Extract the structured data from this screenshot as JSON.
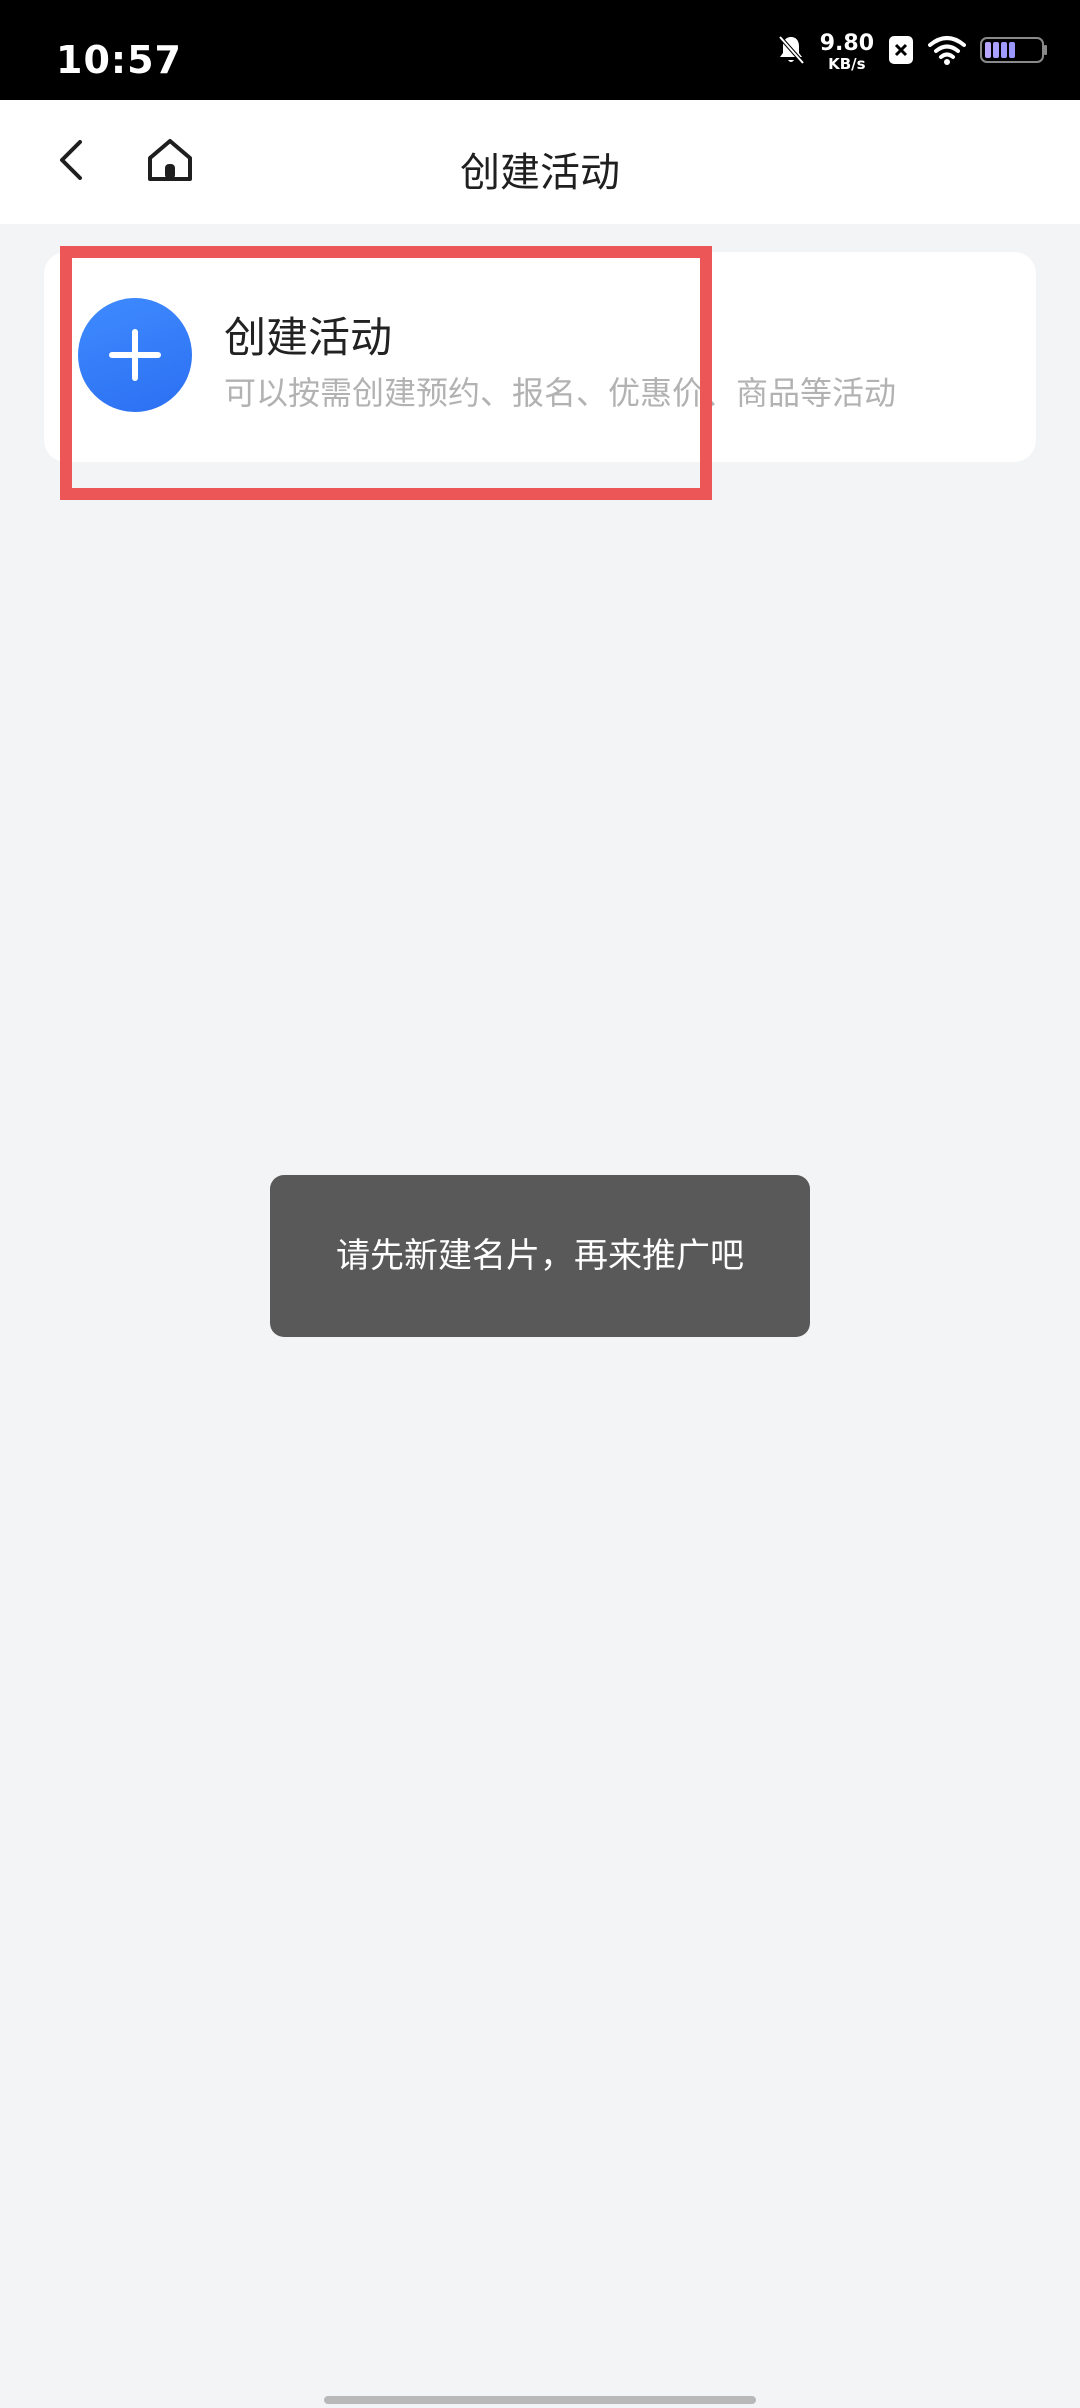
{
  "status_bar": {
    "time": "10:57",
    "net_speed_value": "9.80",
    "net_speed_unit": "KB/s",
    "icons": [
      "bell-mute-icon",
      "close-badge-icon",
      "wifi-icon",
      "battery-icon"
    ]
  },
  "header": {
    "title": "创建活动",
    "back_icon": "chevron-left-icon",
    "home_icon": "home-icon"
  },
  "card": {
    "icon": "plus-circle-icon",
    "title": "创建活动",
    "description": "可以按需创建预约、报名、优惠价、商品等活动",
    "accent_color": "#2f7bf5"
  },
  "toast": {
    "message": "请先新建名片，再来推广吧"
  },
  "colors": {
    "background": "#f3f4f6",
    "highlight_border": "#ec5656",
    "toast_background": "#595959"
  }
}
